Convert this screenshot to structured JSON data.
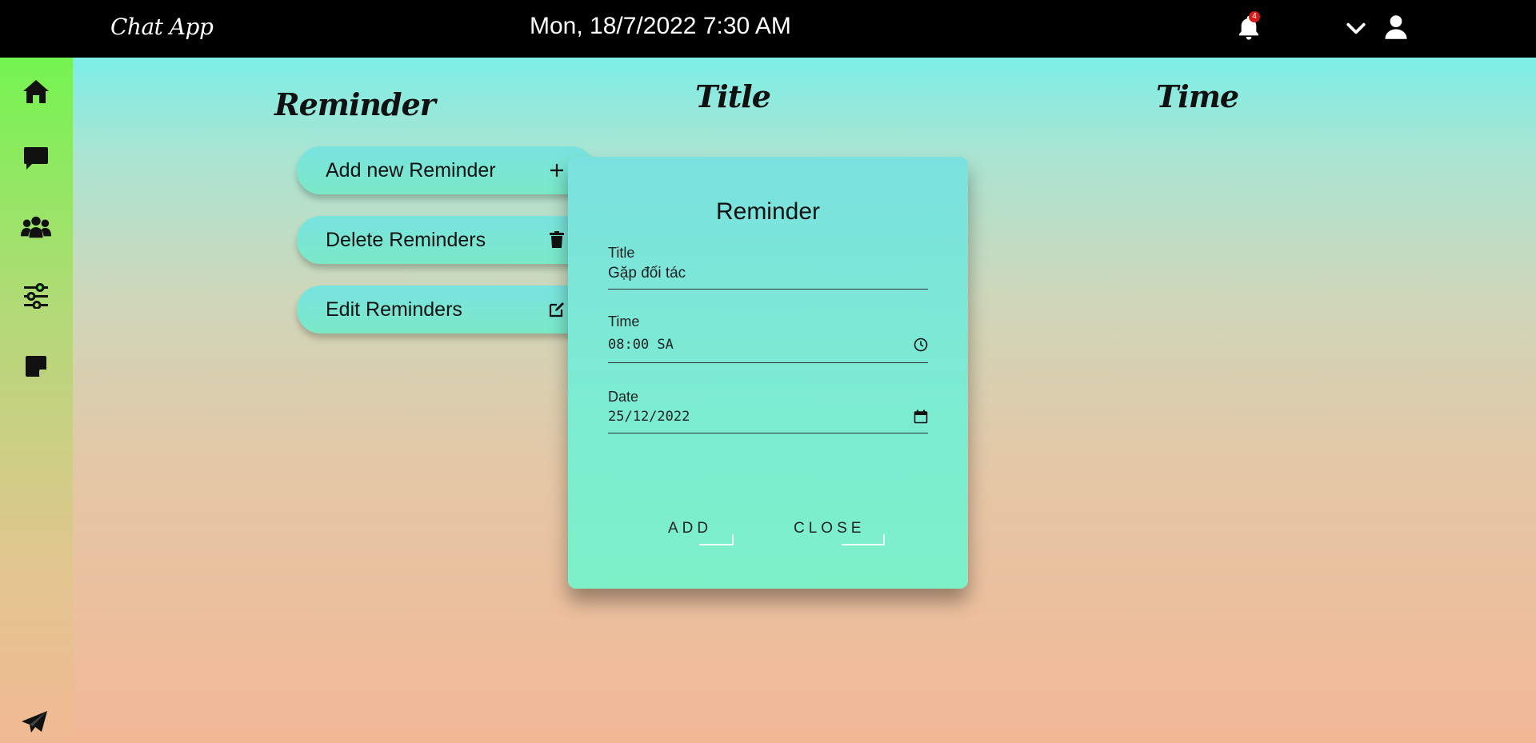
{
  "header": {
    "brand": "Chat App",
    "datetime": "Mon, 18/7/2022 7:30 AM",
    "notification_count": "4"
  },
  "sidebar": {
    "items": [
      {
        "name": "home-icon"
      },
      {
        "name": "chat-icon"
      },
      {
        "name": "groups-icon"
      },
      {
        "name": "settings-sliders-icon"
      },
      {
        "name": "sticky-note-icon"
      }
    ],
    "bottom_icon": "send-icon"
  },
  "main": {
    "columns": {
      "reminder": "Reminder",
      "title": "Title",
      "time": "Time"
    },
    "actions": [
      {
        "label": "Add new Reminder",
        "icon": "plus-icon"
      },
      {
        "label": "Delete Reminders",
        "icon": "trash-icon"
      },
      {
        "label": "Edit Reminders",
        "icon": "edit-icon"
      }
    ]
  },
  "modal": {
    "title": "Reminder",
    "fields": {
      "title": {
        "label": "Title",
        "value": "Gặp đối tác"
      },
      "time": {
        "label": "Time",
        "value": "08:00 SA"
      },
      "date": {
        "label": "Date",
        "value": "25/12/2022"
      }
    },
    "add_label": "ADD",
    "close_label": "CLOSE"
  },
  "colors": {
    "topbar": "#000000",
    "badge": "#d51a1a",
    "button_gradient_top": "#79e3e0",
    "button_gradient_bottom": "#7ae9c7"
  }
}
